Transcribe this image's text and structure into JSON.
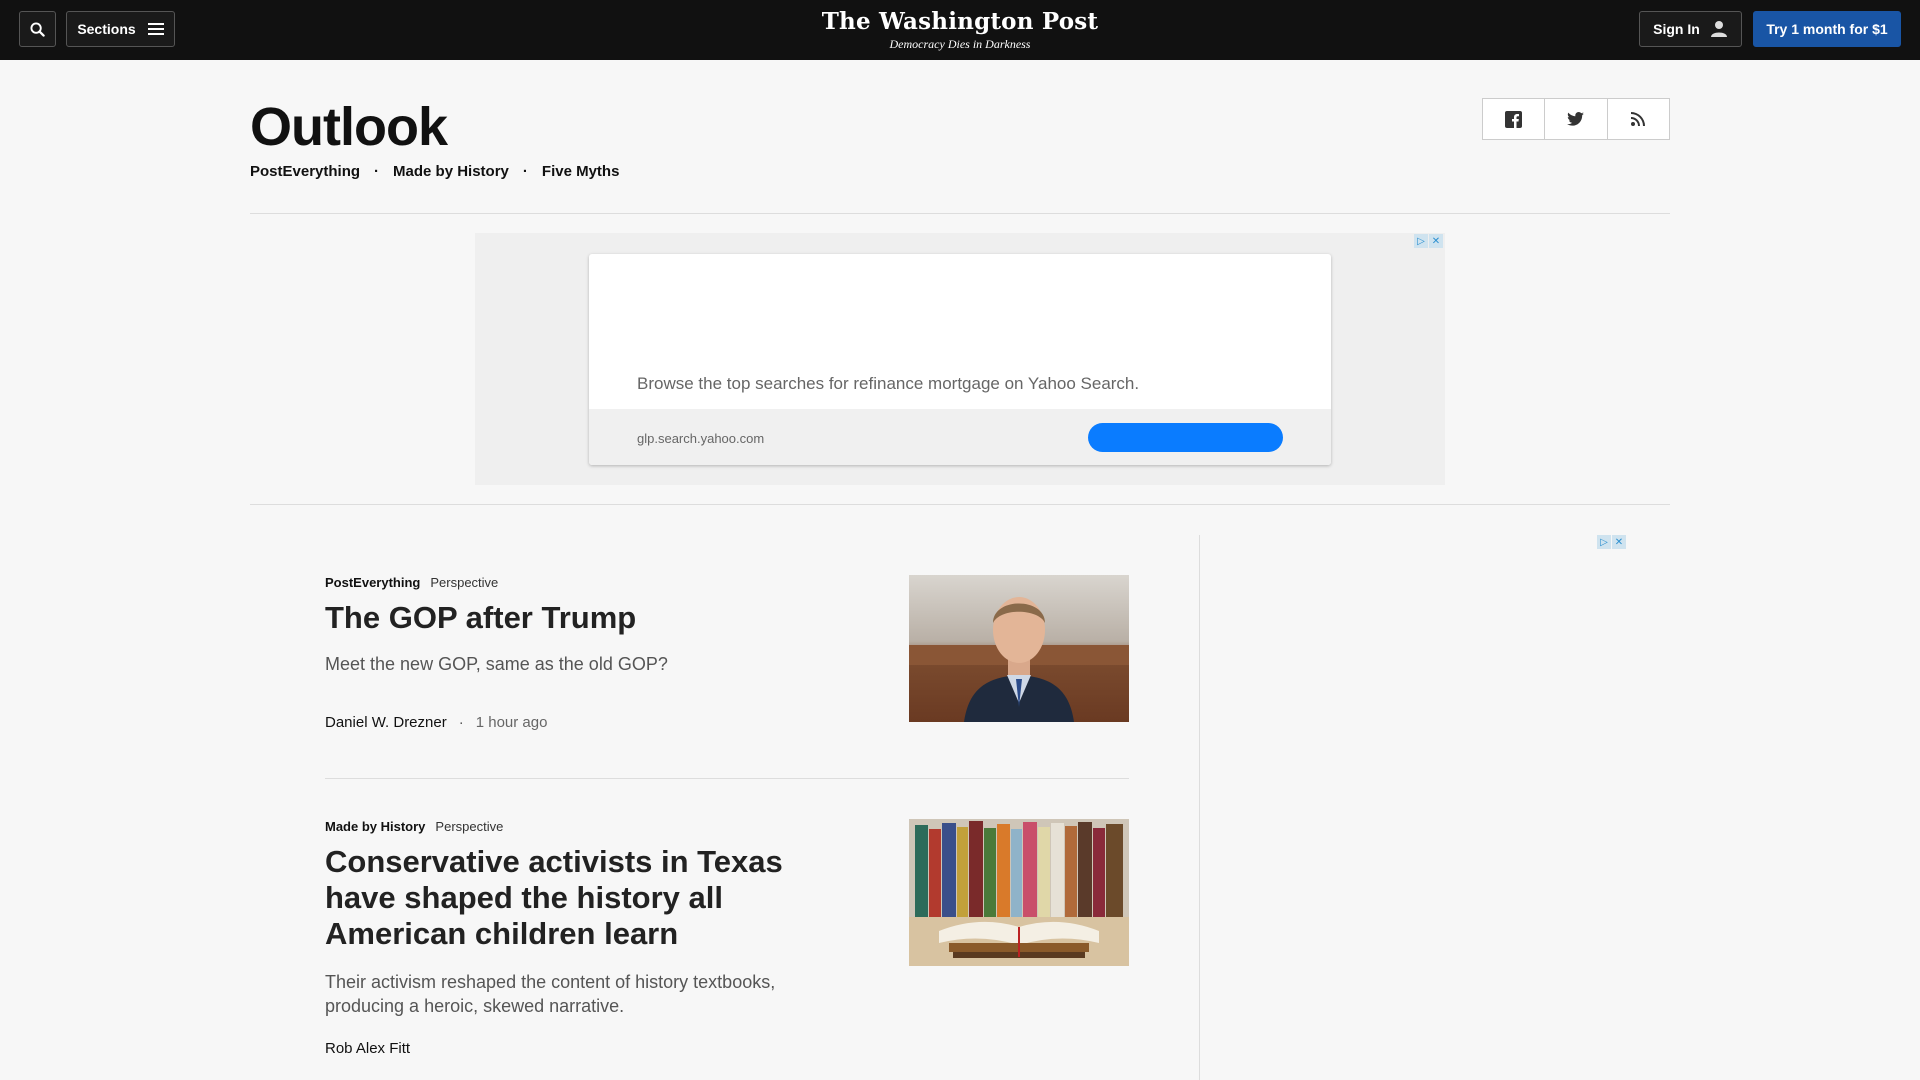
{
  "topbar": {
    "sections_label": "Sections",
    "logo_title": "The Washington Post",
    "logo_tagline": "Democracy Dies in Darkness",
    "signin_label": "Sign In",
    "subscribe_label": "Try 1 month for $1"
  },
  "header": {
    "title": "Outlook",
    "subnav": [
      "PostEverything",
      "Made by History",
      "Five Myths"
    ],
    "subnav_separator": "·"
  },
  "ad": {
    "text": "Browse the top searches for refinance mortgage on Yahoo Search.",
    "url": "glp.search.yahoo.com"
  },
  "articles": [
    {
      "section": "PostEverything",
      "label": "Perspective",
      "headline": "The GOP after Trump",
      "blurb": "Meet the new GOP, same as the old GOP?",
      "author": "Daniel W. Drezner",
      "time": "1 hour ago"
    },
    {
      "section": "Made by History",
      "label": "Perspective",
      "headline": "Conservative activists in Texas have shaped the history all American children learn",
      "blurb": "Their activism reshaped the content of history textbooks, producing a heroic, skewed narrative.",
      "author": "Rob Alex Fitt"
    }
  ],
  "colors": {
    "topbar_bg": "#111111",
    "subscribe_bg": "#1955a5",
    "ad_cta": "#0a7cff"
  }
}
